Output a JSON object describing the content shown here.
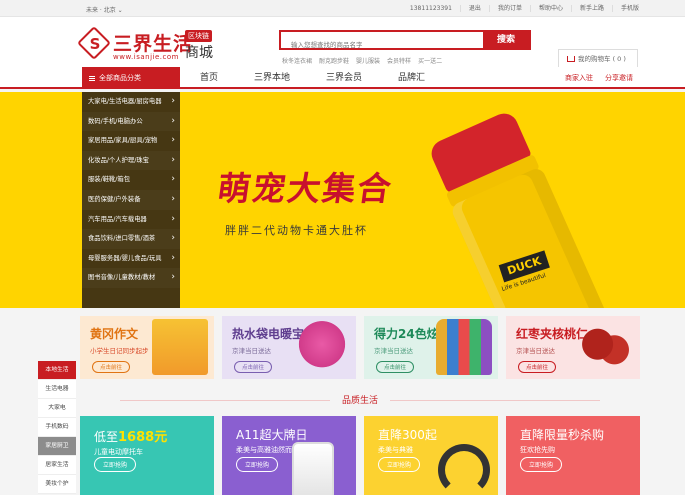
{
  "topbar": {
    "location": "未来 · 北京 ⌄",
    "links": [
      "13811123391",
      "退出",
      "我的订单",
      "帮助中心",
      "新手上路",
      "手机版"
    ]
  },
  "logo": {
    "name": "三界生活",
    "tag": "区块链",
    "url": "www.isanjie.com",
    "suffix": "商城"
  },
  "search": {
    "placeholder": "输入您想查找的商品名字",
    "button": "搜索",
    "hotwords": [
      "秋冬连衣裙",
      "耐克跑步鞋",
      "婴儿服装",
      "会员特样",
      "买一送二"
    ]
  },
  "cart": {
    "label": "我的购物车 ( 0 )"
  },
  "nav": {
    "all_categories": "全部商品分类",
    "items": [
      "首页",
      "三界本地",
      "三界会员",
      "品牌汇"
    ],
    "right": [
      "商家入驻",
      "分享邀请"
    ]
  },
  "categories": [
    "大家电/生活电器/厨房电器",
    "数码/手机/电脑办公",
    "家居用品/家具/厨具/宠物",
    "化妆品/个人护理/珠宝",
    "服装/鞋靴/箱包",
    "医药保健/户外装备",
    "汽车用品/汽车载电器",
    "食品饮料/进口零售/酒茶",
    "母婴服务器/婴儿食品/玩具",
    "图书音像/儿童教材/教材"
  ],
  "banner": {
    "title": "萌宠大集合",
    "subtitle": "胖胖二代动物卡通大肚杯",
    "bottle_label": "DUCK",
    "bottle_sub": "Life is beautiful"
  },
  "promos": [
    {
      "title": "黄冈作文",
      "subtitle": "小学生日记同步起步",
      "pill": "点击前往"
    },
    {
      "title": "热水袋电暖宝",
      "subtitle": "京津当日送达",
      "pill": "点击前往"
    },
    {
      "title": "得力24色炫彩棒",
      "subtitle": "京津当日送达",
      "pill": "点击前往"
    },
    {
      "title": "红枣夹核桃仁",
      "subtitle": "京津当日送达",
      "pill": "点击前往"
    }
  ],
  "floor_nav": [
    "本地生活",
    "生活电器",
    "大家电",
    "手机数码",
    "家居厨卫",
    "居家生活",
    "美妆个护"
  ],
  "floor_title": "品质生活",
  "cards": [
    {
      "title_pre": "低至",
      "title_num": "1688元",
      "subtitle": "儿童电动摩托车",
      "button": "立即抢购"
    },
    {
      "title_pre": "A11超大牌日",
      "title_num": "",
      "subtitle": "柔美与高雅油然而生",
      "button": "立即抢购"
    },
    {
      "title_pre": "直降300起",
      "title_num": "",
      "subtitle": "柔美与典雅",
      "button": "立即抢购"
    },
    {
      "title_pre": "直降限量秒杀购",
      "title_num": "",
      "subtitle": "狂欢抢先购",
      "button": "立即抢购"
    }
  ]
}
